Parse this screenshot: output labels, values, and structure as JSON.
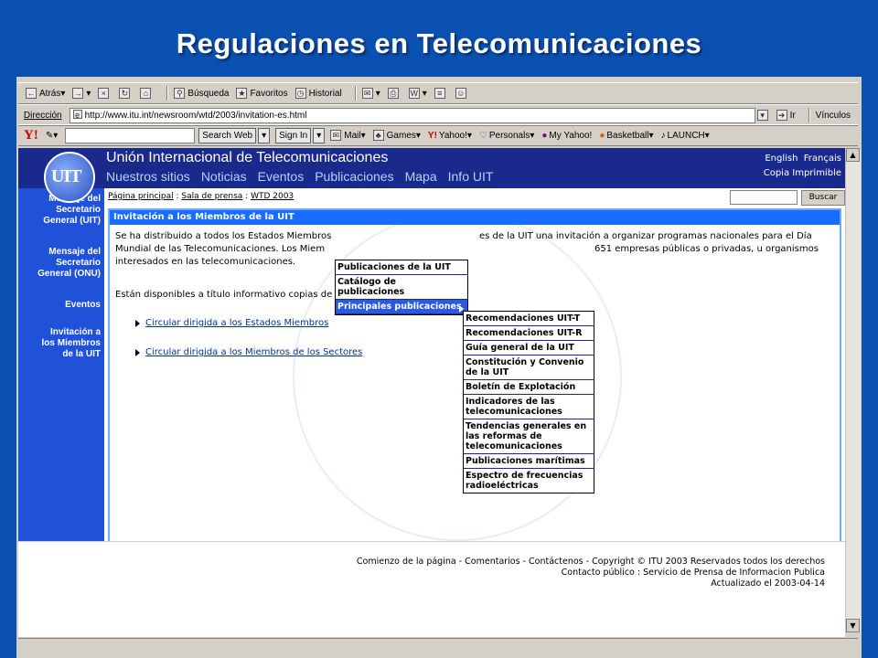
{
  "slide_title": "Regulaciones en Telecomunicaciones",
  "toolbar1": {
    "back": "Atrás",
    "search": "Búsqueda",
    "favorites": "Favoritos",
    "history": "Historial"
  },
  "address": {
    "label": "Dirección",
    "url": "http://www.itu.int/newsroom/wtd/2003/invitation-es.html",
    "go": "Ir",
    "links": "Vínculos"
  },
  "yahoo": {
    "logo": "Y!",
    "search_web": "Search Web",
    "sign_in": "Sign In",
    "items": [
      "Mail",
      "Games",
      "Yahoo!",
      "Personals",
      "My Yahoo!",
      "Basketball",
      "LAUNCH"
    ]
  },
  "itu": {
    "title": "Unión Internacional de Telecomunicaciones",
    "nav": [
      "Nuestros sitios",
      "Noticias",
      "Eventos",
      "Publicaciones",
      "Mapa",
      "Info UIT"
    ],
    "lang": "English  Français",
    "copia": "Copia Imprimible",
    "logo": "UIT",
    "breadcrumb": [
      "Página principal",
      "Sala de prensa",
      "WTD 2003"
    ],
    "buscar": "Buscar",
    "leftnav": [
      "Mensaje del\nSecretario\nGeneral (UIT)",
      "Mensaje del\nSecretario\nGeneral (ONU)",
      "Eventos",
      "Invitación a\nlos Miembros\nde la UIT"
    ],
    "content_head": "Invitación a los Miembros de la UIT",
    "para1_a": "Se ha distribuido a todos los Estados Miembros",
    "para1_b": "es de la UIT una invitación a organizar programas nacionales para el Día",
    "para1_c": "Mundial de las Telecomunicaciones. Los Miem",
    "para1_d": "651 empresas públicas o privadas, u organismos",
    "para1_e": "interesados en las telecomunicaciones.",
    "para2": "Están disponibles a título informativo copias de las circulares y de sus ar",
    "link1": "Circular dirigida a los Estados Miembros",
    "link2": "Circular dirigida a los Miembros de los Sectores"
  },
  "menu1": [
    "Publicaciones de la UIT",
    "Catálogo de publicaciones",
    "Principales publicaciones"
  ],
  "menu2": [
    "Recomendaciones UIT-T",
    "Recomendaciones UIT-R",
    "Guía general de la UIT",
    "Constitución y Convenio de la UIT",
    "Boletín de Explotación",
    "Indicadores de las telecomunicaciones",
    "Tendencias generales en las reformas de telecomunicaciones",
    "Publicaciones marítimas",
    "Espectro de frecuencias radioeléctricas"
  ],
  "footer": {
    "line1": "Comienzo de la página -  Comentarios -  Contáctenos -  Copyright © ITU 2003 Reservados todos los derechos",
    "line2": "Contacto público : Servicio de Prensa de Informacion Publica",
    "line3": "Actualizado el 2003-04-14"
  }
}
